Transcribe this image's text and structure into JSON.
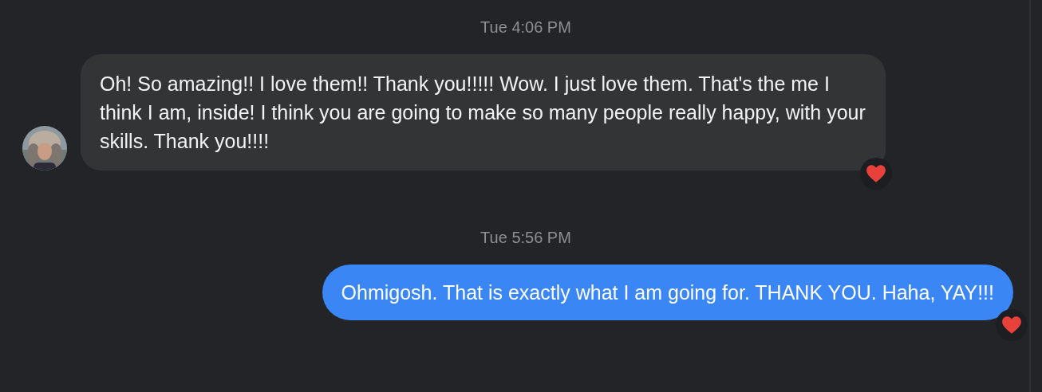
{
  "conversation": [
    {
      "timestamp": "Tue 4:06 PM",
      "message": {
        "kind": "incoming",
        "text": "Oh! So amazing!! I love them!! Thank you!!!!! Wow. I just love them. That's the me I think I am, inside! I think you are going to make so many people really happy, with your skills. Thank you!!!!",
        "reacted": true
      }
    },
    {
      "timestamp": "Tue 5:56 PM",
      "message": {
        "kind": "outgoing",
        "text": "Ohmigosh. That is exactly what I am going for. THANK YOU. Haha, YAY!!!",
        "reacted": true
      }
    }
  ]
}
